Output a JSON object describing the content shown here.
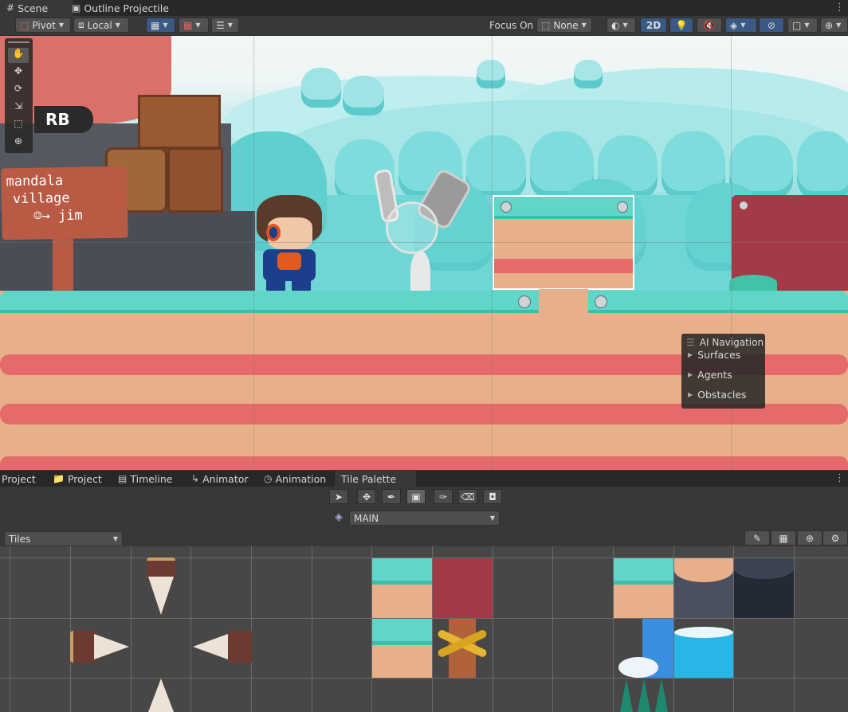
{
  "top_tabs": [
    {
      "label": "Scene",
      "icon": "grid-icon"
    },
    {
      "label": "Outline Projectile",
      "icon": "prefab-icon"
    }
  ],
  "toolbar": {
    "pivot": "Pivot",
    "local": "Local",
    "focus_on_label": "Focus On",
    "focus_value": "None",
    "mode_2d": "2D"
  },
  "scene": {
    "sign_text_line1": "mandala",
    "sign_text_line2": "village",
    "sign_text_line3": "☺→ jim",
    "rb_badge": "RB"
  },
  "ai_navigation": {
    "title": "AI Navigation",
    "items": [
      "Surfaces",
      "Agents",
      "Obstacles"
    ]
  },
  "bottom_tabs": [
    {
      "label": "Project",
      "icon": ""
    },
    {
      "label": "Project",
      "icon": "folder-icon"
    },
    {
      "label": "Timeline",
      "icon": "timeline-icon"
    },
    {
      "label": "Animator",
      "icon": "animator-icon"
    },
    {
      "label": "Animation",
      "icon": "clock-icon"
    },
    {
      "label": "Tile Palette",
      "icon": ""
    }
  ],
  "tile_palette": {
    "palette_name": "MAIN",
    "brush_dropdown": "Tiles",
    "tools": [
      "select-tool-icon",
      "move-tool-icon",
      "brush-tool-icon",
      "box-fill-tool-icon",
      "picker-tool-icon",
      "eraser-tool-icon",
      "fill-tool-icon"
    ]
  },
  "colors": {
    "editor_bg": "#383838",
    "tabbar_bg": "#282828",
    "accent_blue": "#3a5a85",
    "grass": "#5fd6c8",
    "sand": "#e8b08a",
    "stripe_red": "#e56a6a",
    "crate_brown": "#9a5a34"
  }
}
